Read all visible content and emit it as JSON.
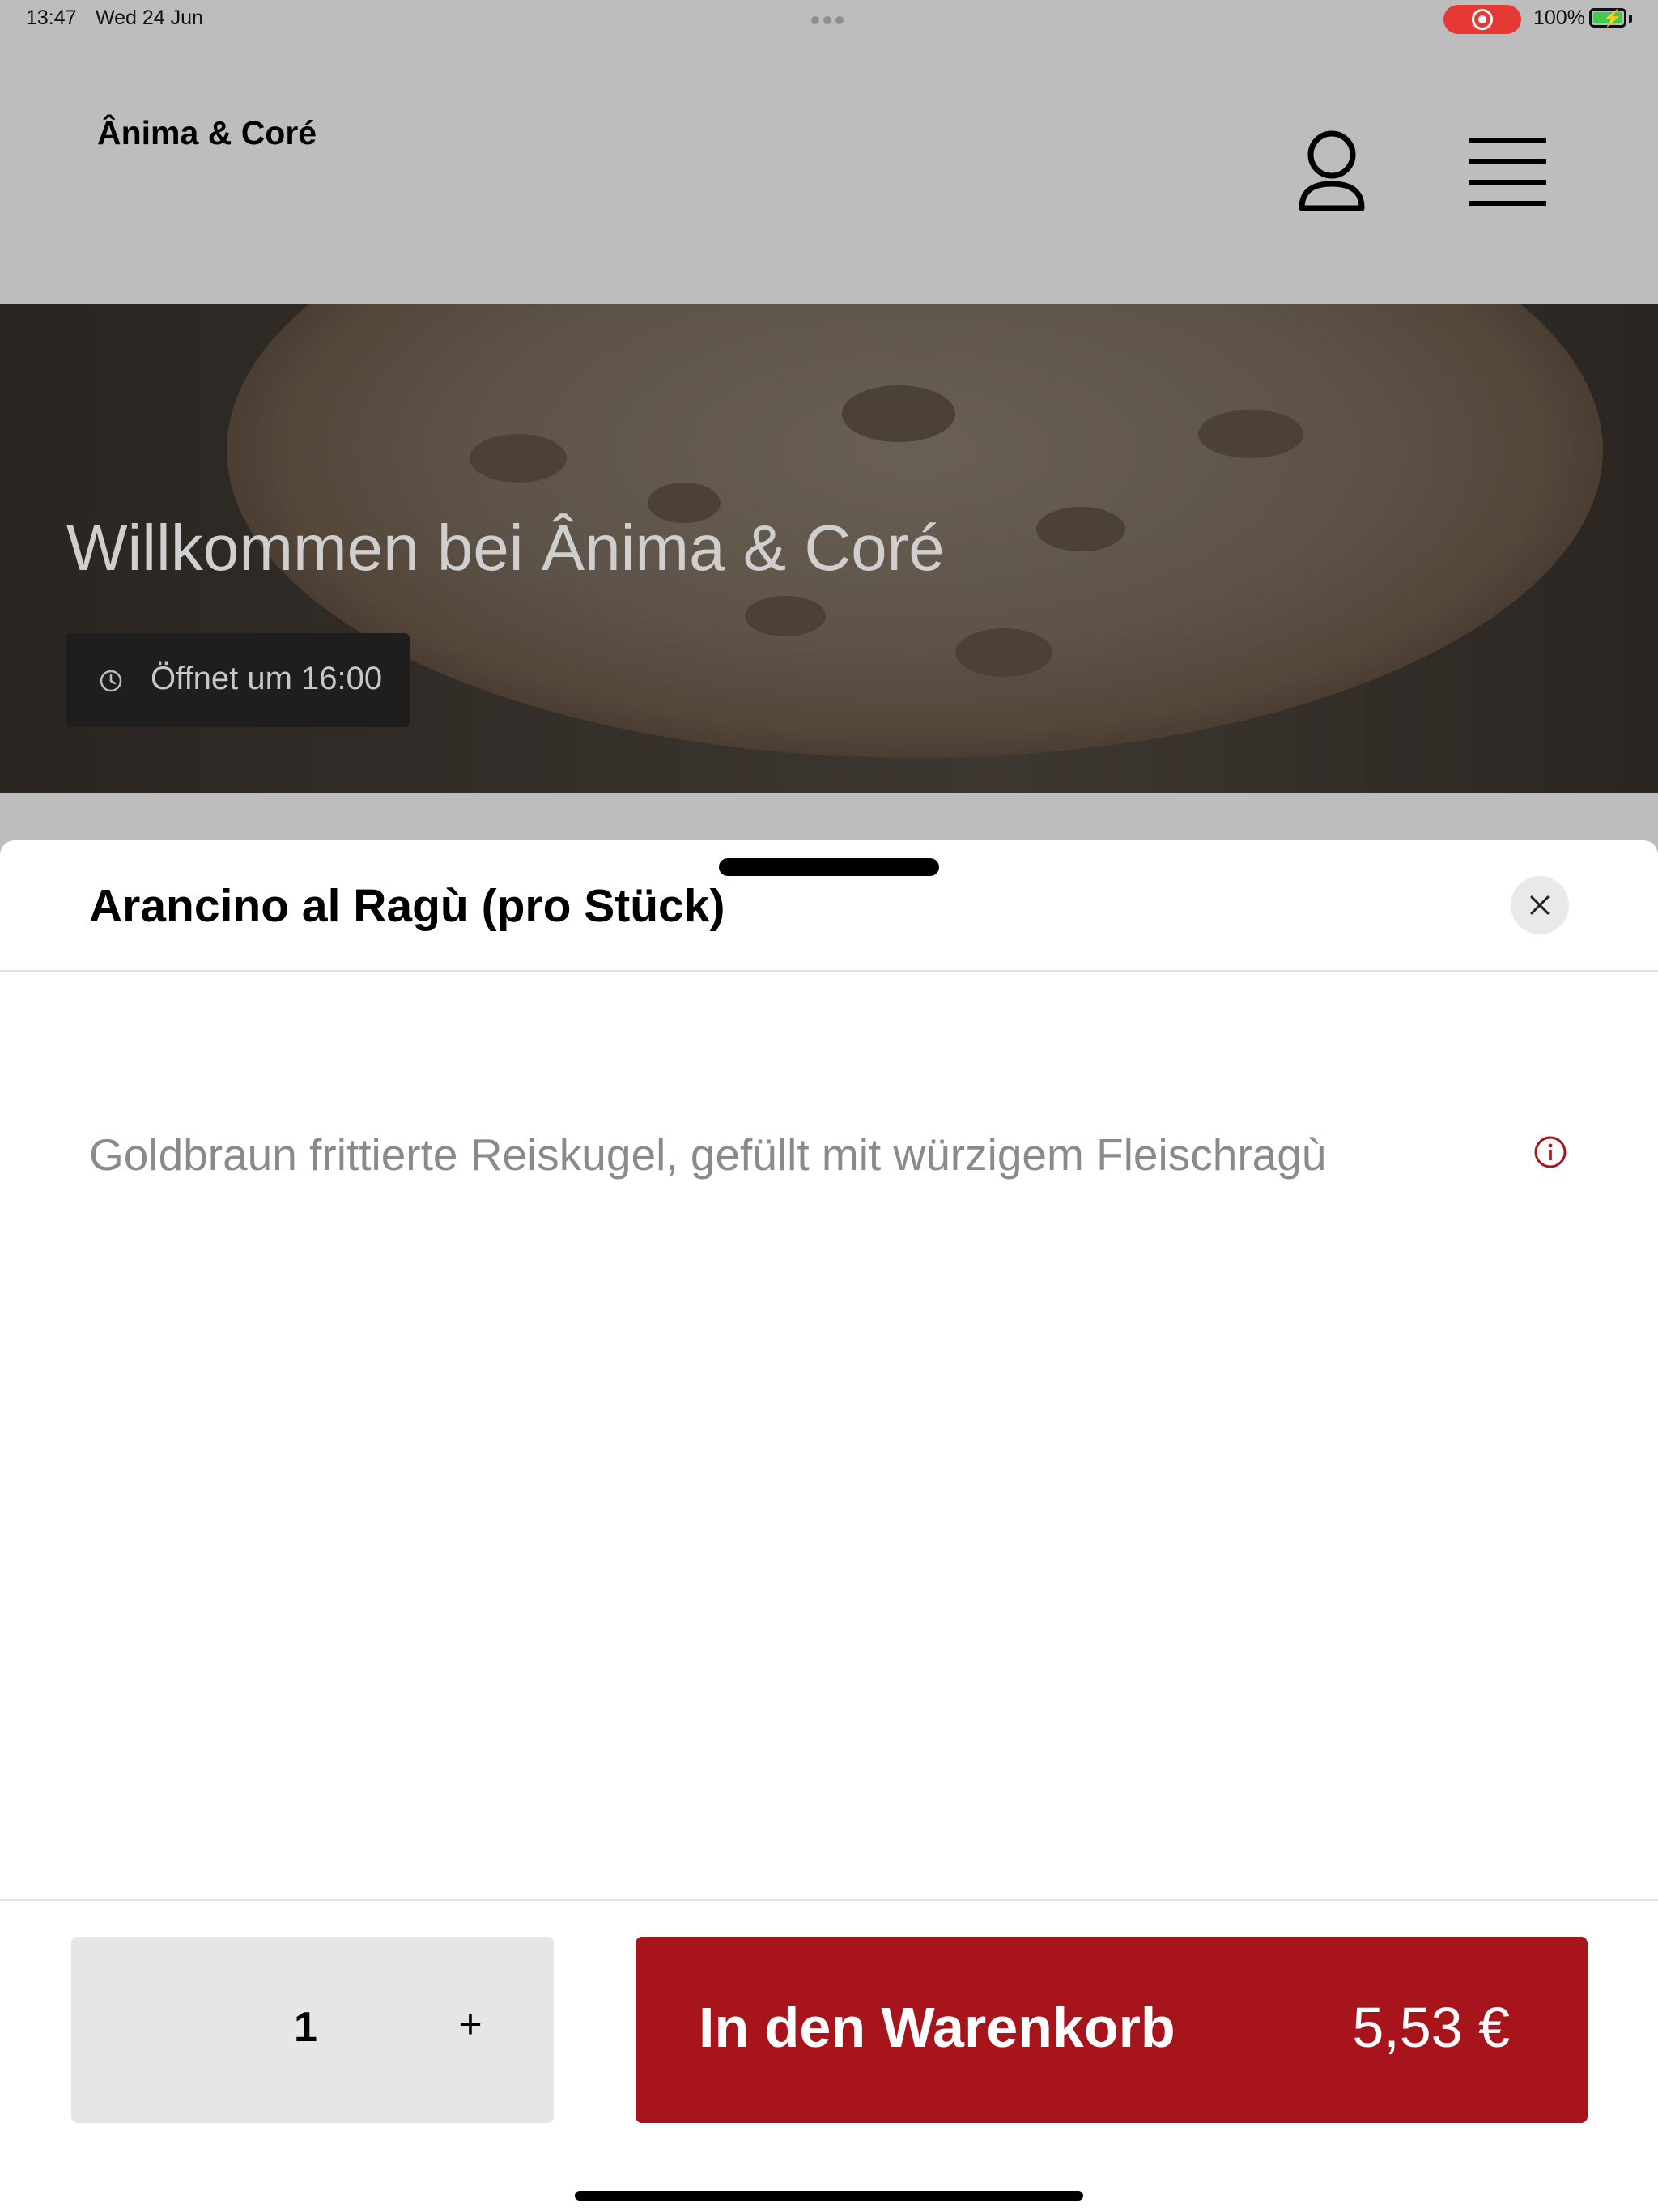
{
  "status_bar": {
    "time": "13:47",
    "date": "Wed 24 Jun",
    "battery_percent": "100%",
    "recording_color": "#e53935",
    "battery_color": "#3ecb4f"
  },
  "header": {
    "brand": "Ânima & Coré",
    "user_icon": "user-icon",
    "menu_icon": "menu-icon"
  },
  "hero": {
    "title": "Willkommen bei Ânima & Coré",
    "open_status": "Öffnet um 16:00",
    "clock_icon": "clock-icon"
  },
  "sheet": {
    "title": "Arancino al Ragù (pro Stück)",
    "description": "Goldbraun frittierte Reiskugel, gefüllt mit würzigem Fleischragù",
    "close_icon": "close-icon",
    "info_icon": "info-icon"
  },
  "order": {
    "quantity": "1",
    "plus_label": "+",
    "cart_label": "In den Warenkorb",
    "price": "5,53 €",
    "cart_color": "#a8141c"
  }
}
